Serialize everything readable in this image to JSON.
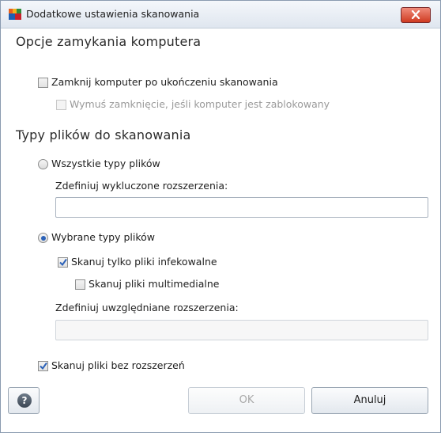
{
  "window": {
    "title": "Dodatkowe ustawienia skanowania",
    "close_icon": "close-icon",
    "app_icon": "avg-logo-icon"
  },
  "shutdown_section": {
    "title": "Opcje zamykania komputera",
    "shutdown_checkbox": {
      "label": "Zamknij komputer po ukończeniu skanowania",
      "checked": false
    },
    "force_checkbox": {
      "label": "Wymuś zamknięcie, jeśli komputer jest zablokowany",
      "checked": false,
      "disabled": true
    }
  },
  "file_types_section": {
    "title": "Typy plików do skanowania",
    "all_types_radio": {
      "label": "Wszystkie typy plików",
      "selected": false
    },
    "exclude_label": "Zdefiniuj wykluczone rozszerzenia:",
    "exclude_value": "",
    "selected_types_radio": {
      "label": "Wybrane typy plików",
      "selected": true
    },
    "infectable_checkbox": {
      "label": "Skanuj tylko pliki infekowalne",
      "checked": true
    },
    "multimedia_checkbox": {
      "label": "Skanuj pliki multimedialne",
      "checked": false
    },
    "include_label": "Zdefiniuj uwzględniane rozszerzenia:",
    "include_value": "",
    "no_ext_checkbox": {
      "label": "Skanuj pliki bez rozszerzeń",
      "checked": true
    }
  },
  "buttons": {
    "help_label": "?",
    "ok_label": "OK",
    "cancel_label": "Anuluj"
  },
  "colors": {
    "accent": "#2c62b8",
    "close_red": "#cf3b22"
  }
}
